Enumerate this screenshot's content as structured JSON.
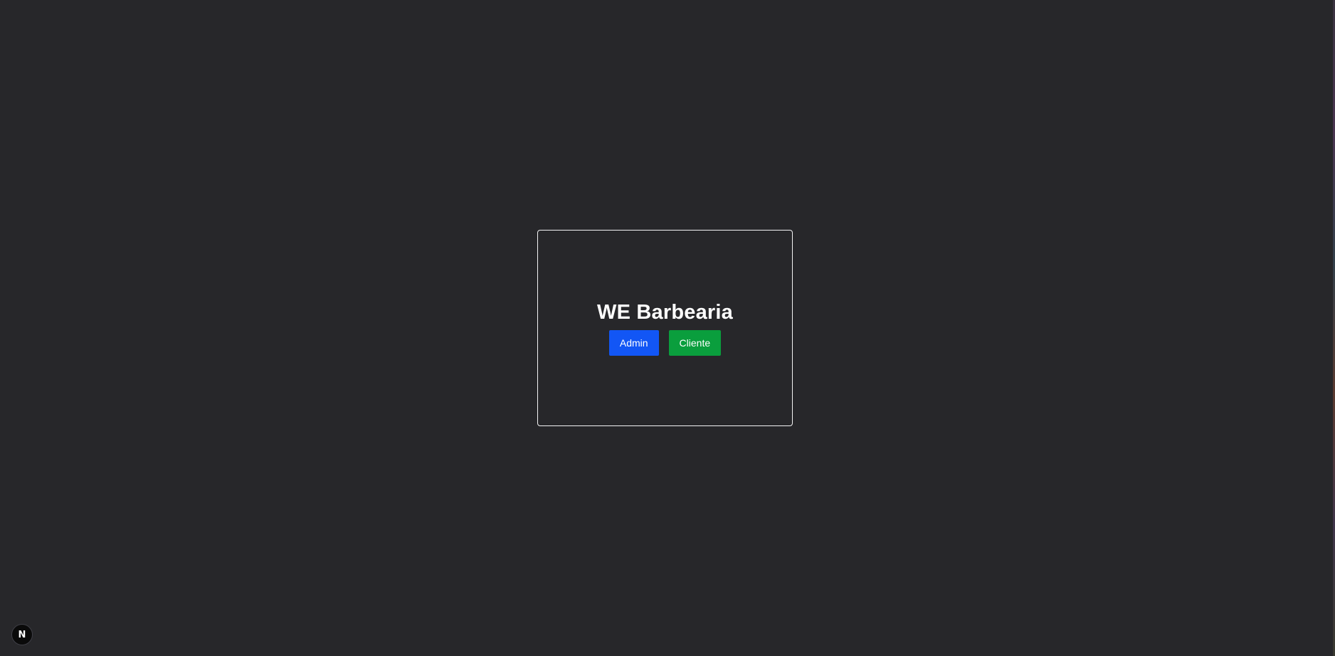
{
  "app": {
    "title": "WE Barbearia"
  },
  "actions": {
    "admin_label": "Admin",
    "cliente_label": "Cliente"
  },
  "dev_indicator": {
    "label": "N"
  },
  "colors": {
    "background": "#27272a",
    "admin_button": "#1256f5",
    "cliente_button": "#0a9e3d",
    "card_border": "#f4f4f5"
  }
}
